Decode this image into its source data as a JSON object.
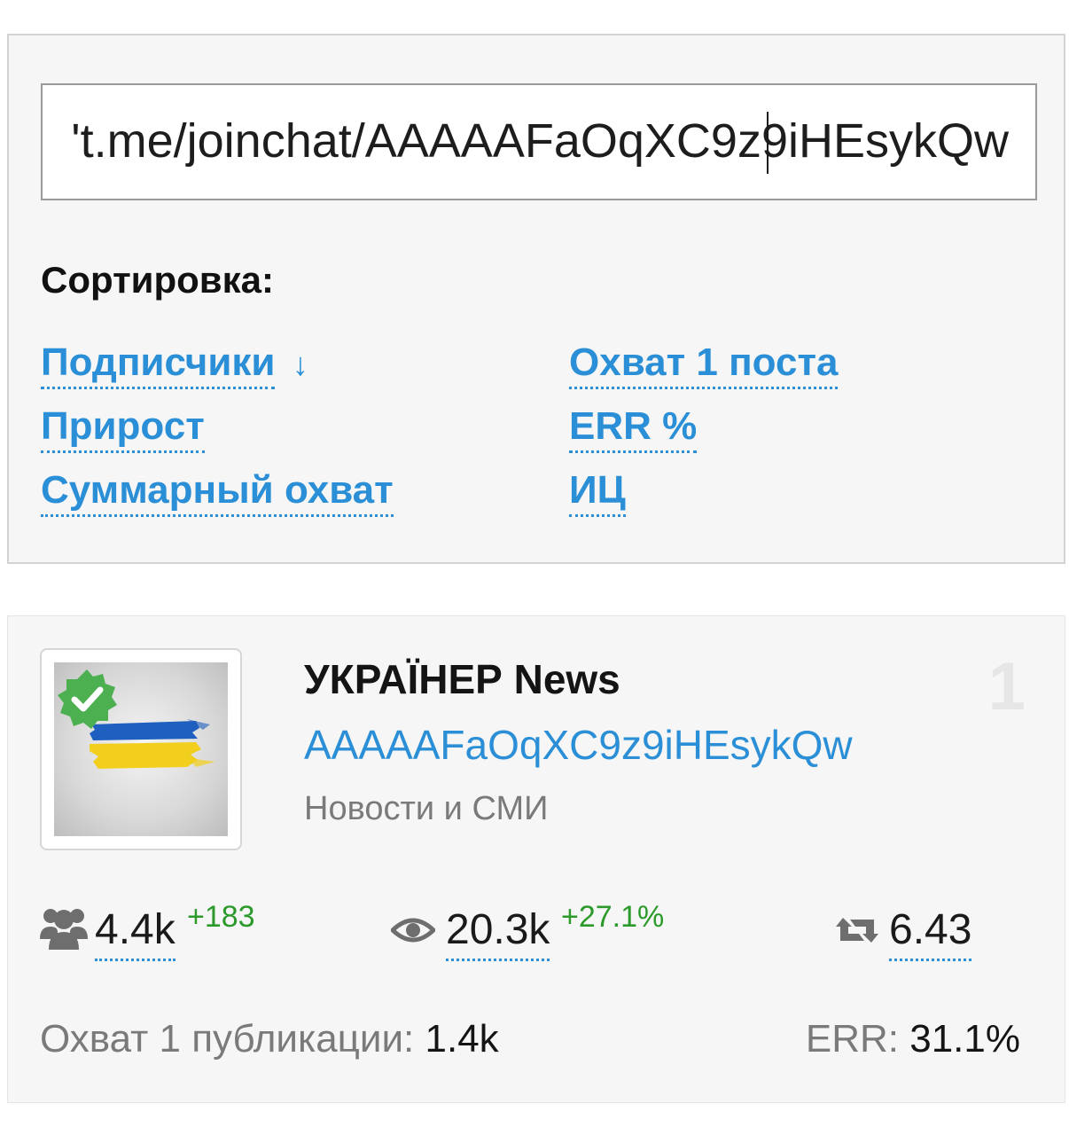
{
  "search": {
    "value": "'t.me/joinchat/AAAAAFaOqXC9z9iHEsykQw"
  },
  "sorting": {
    "title": "Сортировка:",
    "options": [
      {
        "label": "Подписчики",
        "active_arrow": "↓"
      },
      {
        "label": "Прирост"
      },
      {
        "label": "Суммарный охват"
      },
      {
        "label": "Охват 1 поста"
      },
      {
        "label": "ERR %"
      },
      {
        "label": "ИЦ"
      }
    ]
  },
  "channel": {
    "title": "УКРАЇНЕР News",
    "id": "AAAAAFaOqXC9z9iHEsykQw",
    "category": "Новости и СМИ",
    "rank": "1",
    "verified": true,
    "stats": {
      "subscribers": {
        "value": "4.4k",
        "delta": "+183",
        "icon": "users-icon"
      },
      "views": {
        "value": "20.3k",
        "delta": "+27.1%",
        "icon": "eye-icon"
      },
      "reposts": {
        "value": "6.43",
        "icon": "retweet-icon"
      }
    },
    "reach_label": "Охват 1 публикации:",
    "reach_value": "1.4k",
    "err_label": "ERR:",
    "err_value": "31.1%"
  },
  "colors": {
    "link": "#2a8fd6",
    "positive": "#2b9a2b",
    "verified_badge": "#4caf50"
  }
}
